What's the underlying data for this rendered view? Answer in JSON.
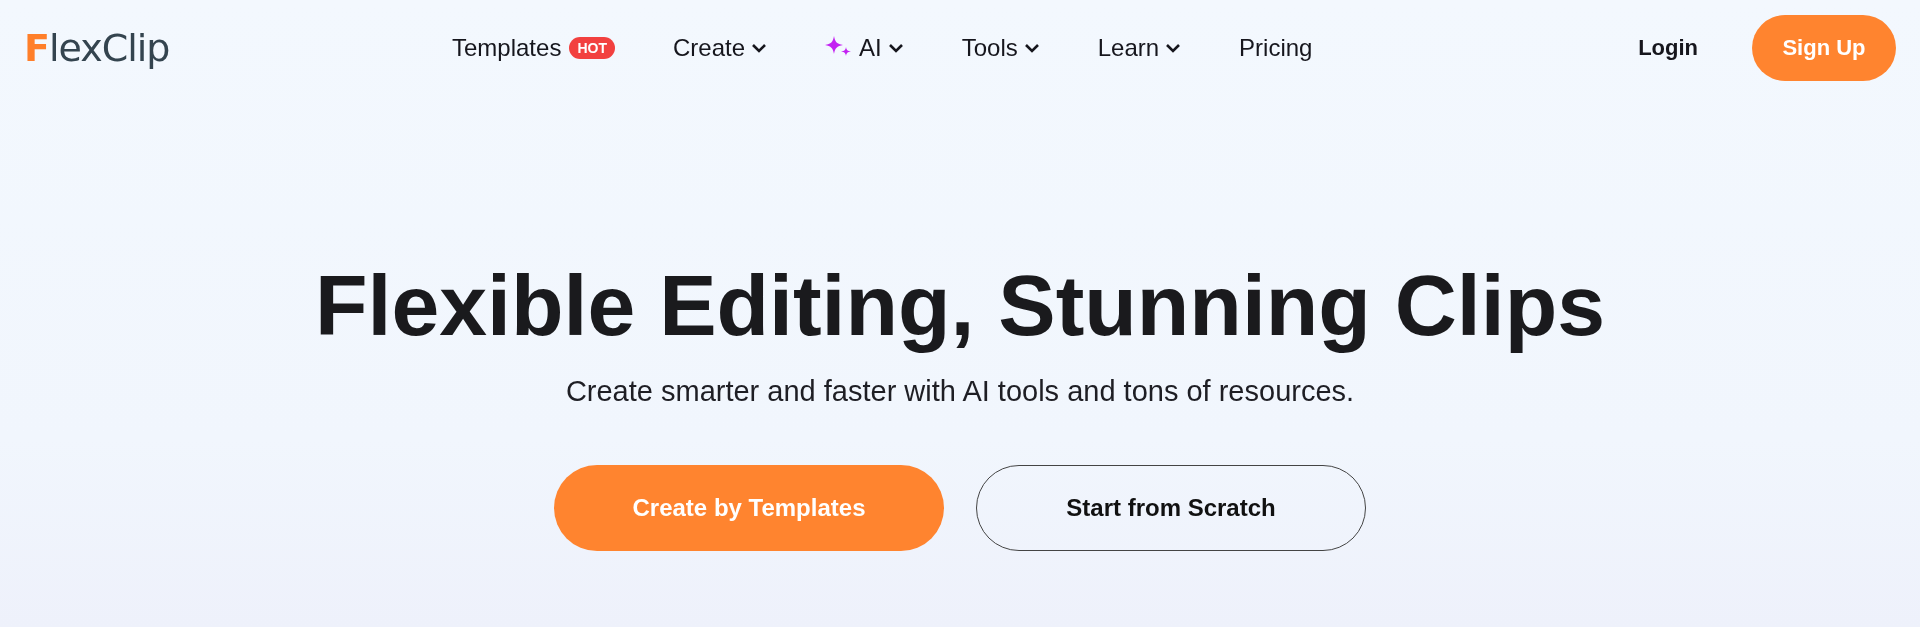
{
  "logo": {
    "first": "F",
    "rest": "lexClip"
  },
  "nav": [
    {
      "label": "Templates",
      "kind": "link",
      "badge": "HOT"
    },
    {
      "label": "Create",
      "kind": "menu"
    },
    {
      "label": "AI",
      "kind": "ai-menu"
    },
    {
      "label": "Tools",
      "kind": "menu"
    },
    {
      "label": "Learn",
      "kind": "menu"
    },
    {
      "label": "Pricing",
      "kind": "link"
    }
  ],
  "login": "Login",
  "signup": "Sign Up",
  "hero": {
    "title": "Flexible Editing, Stunning Clips",
    "subtitle": "Create smarter and faster with AI tools and tons of resources.",
    "buttons": [
      {
        "label": "Create by Templates",
        "kind": "primary"
      },
      {
        "label": "Start from Scratch",
        "kind": "outline"
      }
    ]
  }
}
